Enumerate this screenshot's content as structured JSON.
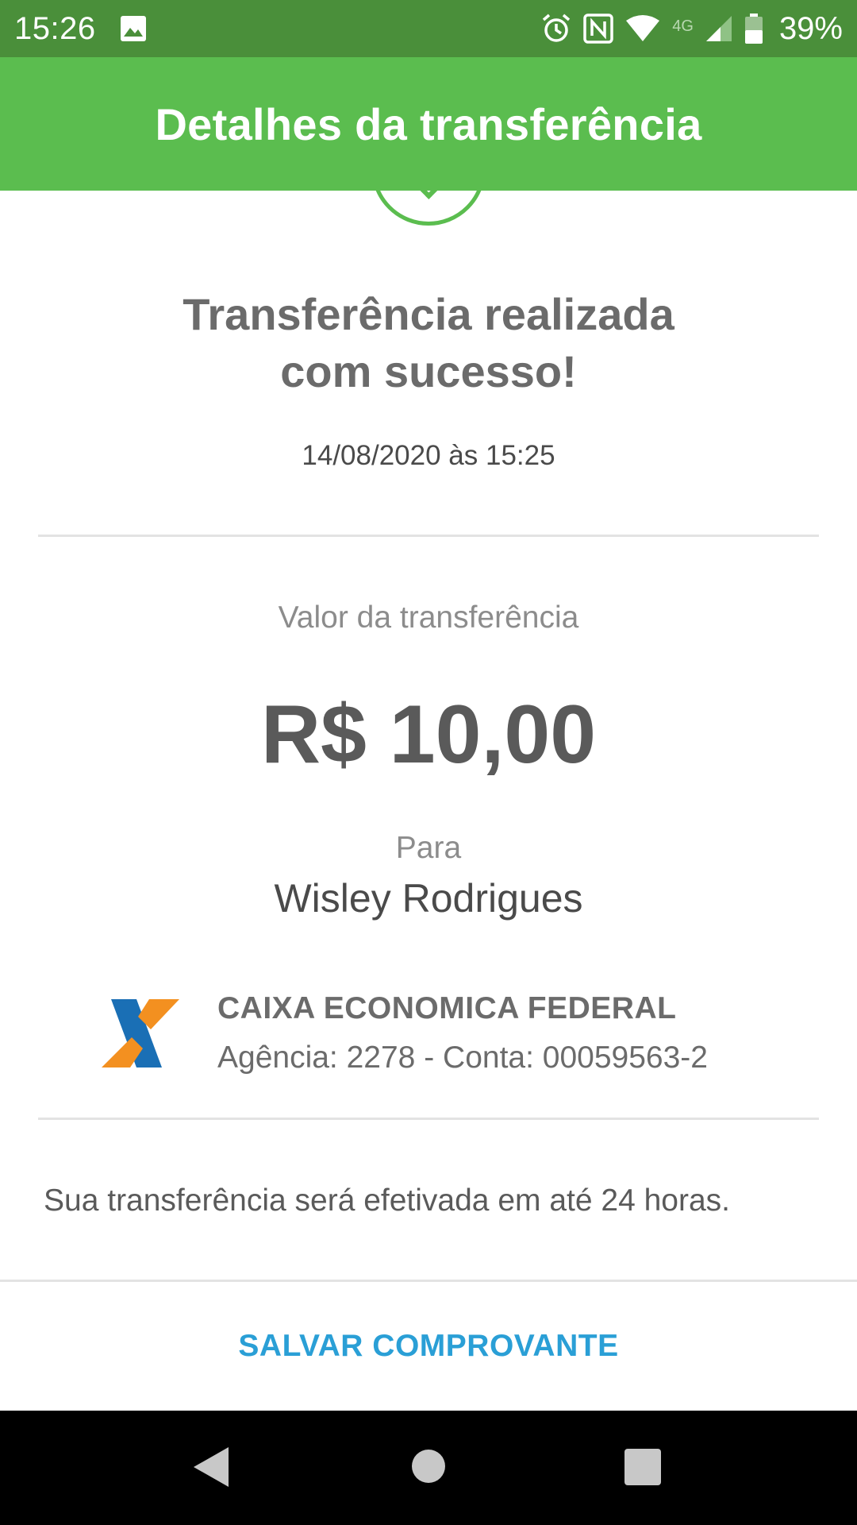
{
  "status_bar": {
    "time": "15:26",
    "network_label": "4G",
    "battery_percent": "39%",
    "icons": [
      "image-icon",
      "alarm-icon",
      "nfc-icon",
      "wifi-icon",
      "signal-icon",
      "battery-icon"
    ]
  },
  "app_bar": {
    "title": "Detalhes da transferência"
  },
  "receipt": {
    "success_line_1": "Transferência realizada",
    "success_line_2": "com sucesso!",
    "datetime": "14/08/2020 às 15:25",
    "amount_label": "Valor da transferência",
    "amount": "R$ 10,00",
    "to_label": "Para",
    "recipient_name": "Wisley Rodrigues",
    "bank_name": "CAIXA ECONOMICA FEDERAL",
    "bank_account": "Agência: 2278 - Conta: 00059563-2",
    "info_text": "Sua transferência será efetivada em até 24 horas.",
    "save_button_label": "SALVAR COMPROVANTE"
  },
  "colors": {
    "status_bar": "#4a8f3a",
    "app_bar": "#5bbd4f",
    "accent_link": "#2a9fd6",
    "logo_blue": "#1a6fb5",
    "logo_orange": "#f39020"
  }
}
